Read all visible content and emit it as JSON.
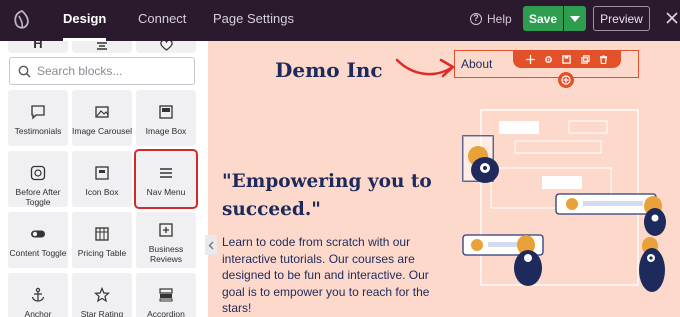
{
  "topbar": {
    "tabs": [
      {
        "label": "Design",
        "active": true
      },
      {
        "label": "Connect",
        "active": false
      },
      {
        "label": "Page Settings",
        "active": false
      }
    ],
    "help_label": "Help",
    "save_label": "Save",
    "preview_label": "Preview"
  },
  "sidebar": {
    "top_tiles": [
      {
        "icon": "heading-icon",
        "glyph": "H"
      },
      {
        "icon": "list-icon",
        "glyph": ""
      },
      {
        "icon": "heart-icon",
        "glyph": ""
      }
    ],
    "search_placeholder": "Search blocks...",
    "blocks": [
      {
        "label": "Testimonials",
        "icon": "chat-bubble-icon"
      },
      {
        "label": "Image Carousel",
        "icon": "image-carousel-icon"
      },
      {
        "label": "Image Box",
        "icon": "image-box-icon"
      },
      {
        "label": "Before After Toggle",
        "icon": "before-after-icon"
      },
      {
        "label": "Icon Box",
        "icon": "icon-box-icon"
      },
      {
        "label": "Nav Menu",
        "icon": "menu-icon",
        "highlighted": true
      },
      {
        "label": "Content Toggle",
        "icon": "toggle-icon"
      },
      {
        "label": "Pricing Table",
        "icon": "pricing-table-icon"
      },
      {
        "label": "Business Reviews",
        "icon": "reviews-icon"
      },
      {
        "label": "Anchor",
        "icon": "anchor-icon"
      },
      {
        "label": "Star Rating",
        "icon": "star-icon"
      },
      {
        "label": "Accordion",
        "icon": "accordion-icon"
      }
    ]
  },
  "canvas": {
    "brand": "Demo Inc",
    "nav_item": "About",
    "headline": "\"Empowering you to succeed.\"",
    "paragraph": "Learn to code from scratch with our interactive tutorials. Our courses are designed to be fun and interactive. Our goal is to empower you to reach for the stars!"
  },
  "colors": {
    "topbar_bg": "#2b1a2e",
    "save_green": "#2e9d4f",
    "canvas_bg": "#fcd9cb",
    "accent_orange": "#e2512a",
    "text_navy": "#1f2a5c",
    "highlight_red": "#d12a2a"
  }
}
